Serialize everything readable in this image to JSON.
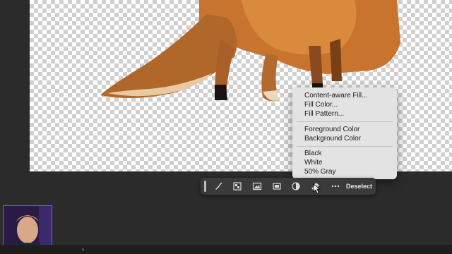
{
  "context_menu": {
    "group1": [
      "Content-aware Fill...",
      "Fill Color...",
      "Fill Pattern..."
    ],
    "group2": [
      "Foreground Color",
      "Background Color"
    ],
    "group3": [
      "Black",
      "White",
      "50% Gray"
    ]
  },
  "taskbar": {
    "deselect_label": "Deselect",
    "icons": [
      "brush-icon",
      "adjust-selection-icon",
      "generate-image-icon",
      "mask-icon",
      "adjustment-circle-icon",
      "fill-icon",
      "more-icon"
    ]
  },
  "bottom_bar": {
    "arrow": "›"
  }
}
